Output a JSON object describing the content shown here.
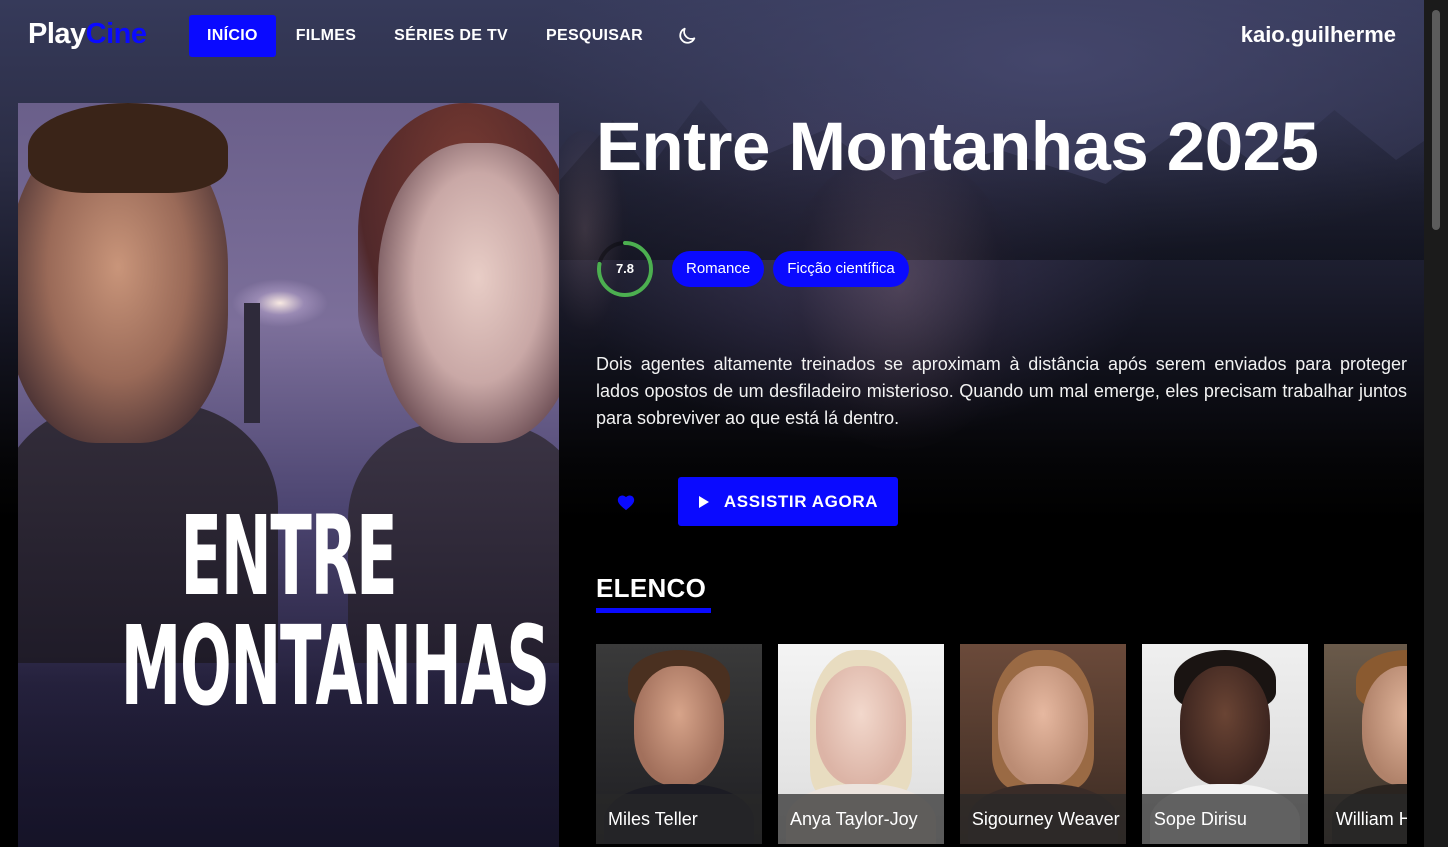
{
  "app": {
    "logo_play": "Play",
    "logo_cine": "Cine",
    "brand_color": "#0a0aff"
  },
  "nav": {
    "items": [
      {
        "label": "INÍCIO",
        "active": true
      },
      {
        "label": "FILMES",
        "active": false
      },
      {
        "label": "SÉRIES DE TV",
        "active": false
      },
      {
        "label": "PESQUISAR",
        "active": false
      }
    ],
    "theme_icon": "moon-icon",
    "username": "kaio.guilherme"
  },
  "poster": {
    "title_line1": "ENTRE",
    "title_line2": "MONTANHAS"
  },
  "movie": {
    "title": "Entre Montanhas 2025",
    "rating": "7.8",
    "rating_fraction": 0.78,
    "genres": [
      "Romance",
      "Ficção científica"
    ],
    "synopsis": "Dois agentes altamente treinados se aproximam à distância após serem enviados para proteger lados opostos de um desfiladeiro misterioso. Quando um mal emerge, eles precisam trabalhar juntos para sobreviver ao que está lá dentro.",
    "favorite_icon": "heart-icon",
    "watch_label": "ASSISTIR AGORA",
    "watch_icon": "play-icon"
  },
  "cast": {
    "heading": "ELENCO",
    "members": [
      {
        "name": "Miles Teller"
      },
      {
        "name": "Anya Taylor-Joy"
      },
      {
        "name": "Sigourney Weaver"
      },
      {
        "name": "Sope Dirisu"
      },
      {
        "name": "William Hope"
      }
    ]
  }
}
